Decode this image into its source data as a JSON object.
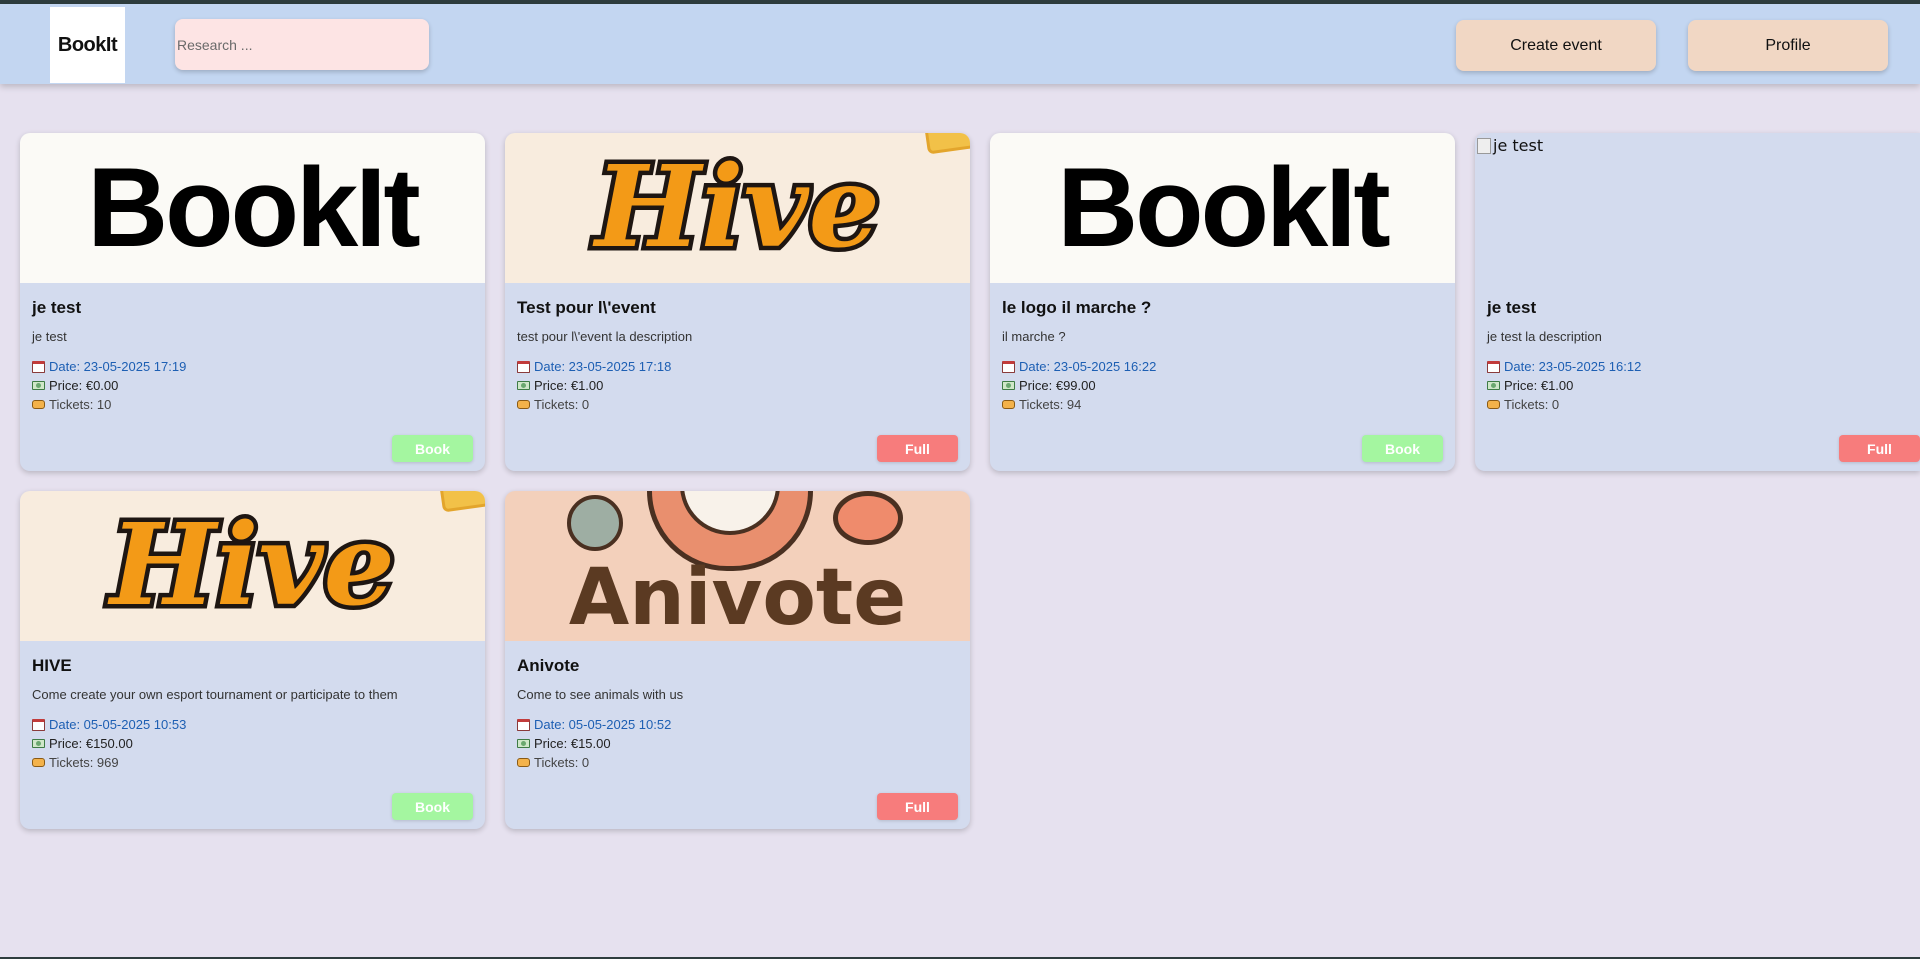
{
  "header": {
    "logo_text": "BookIt",
    "search": {
      "placeholder": "Research ..."
    },
    "create_event_label": "Create event",
    "profile_label": "Profile"
  },
  "events": [
    {
      "image_text": "BookIt",
      "title": "je test",
      "description": "je test",
      "date": "Date: 23-05-2025 17:19",
      "price": "Price: €0.00",
      "tickets": "Tickets: 10",
      "button_label": "Book",
      "status": "available"
    },
    {
      "image_text": "Hive",
      "title": "Test pour l\\'event",
      "description": "test pour l\\'event la description",
      "date": "Date: 23-05-2025 17:18",
      "price": "Price: €1.00",
      "tickets": "Tickets: 0",
      "button_label": "Full",
      "status": "full"
    },
    {
      "image_text": "BookIt",
      "title": "le logo il marche ?",
      "description": "il marche ?",
      "date": "Date: 23-05-2025 16:22",
      "price": "Price: €99.00",
      "tickets": "Tickets: 94",
      "button_label": "Book",
      "status": "available"
    },
    {
      "image_alt": "je test",
      "title": "je test",
      "description": "je test la description",
      "date": "Date: 23-05-2025 16:12",
      "price": "Price: €1.00",
      "tickets": "Tickets: 0",
      "button_label": "Full",
      "status": "full"
    },
    {
      "image_text": "Hive",
      "title": "HIVE",
      "description": "Come create your own esport tournament or participate to them",
      "date": "Date: 05-05-2025 10:53",
      "price": "Price: €150.00",
      "tickets": "Tickets: 969",
      "button_label": "Book",
      "status": "available"
    },
    {
      "image_text": "Anivote",
      "title": "Anivote",
      "description": "Come to see animals with us",
      "date": "Date: 05-05-2025 10:52",
      "price": "Price: €15.00",
      "tickets": "Tickets: 0",
      "button_label": "Full",
      "status": "full"
    }
  ],
  "colors": {
    "header_bg": "#c3d6f1",
    "page_bg": "#e6e1ef",
    "card_bg": "#d3dbee",
    "book_button": "#a4f6a0",
    "full_button": "#f77c7c",
    "nav_button": "#f1d7c4",
    "search_bg": "#fde4e4",
    "date_text": "#1d5fb3"
  },
  "icons": {
    "date": "calendar-icon",
    "price": "money-icon",
    "tickets": "ticket-icon"
  }
}
